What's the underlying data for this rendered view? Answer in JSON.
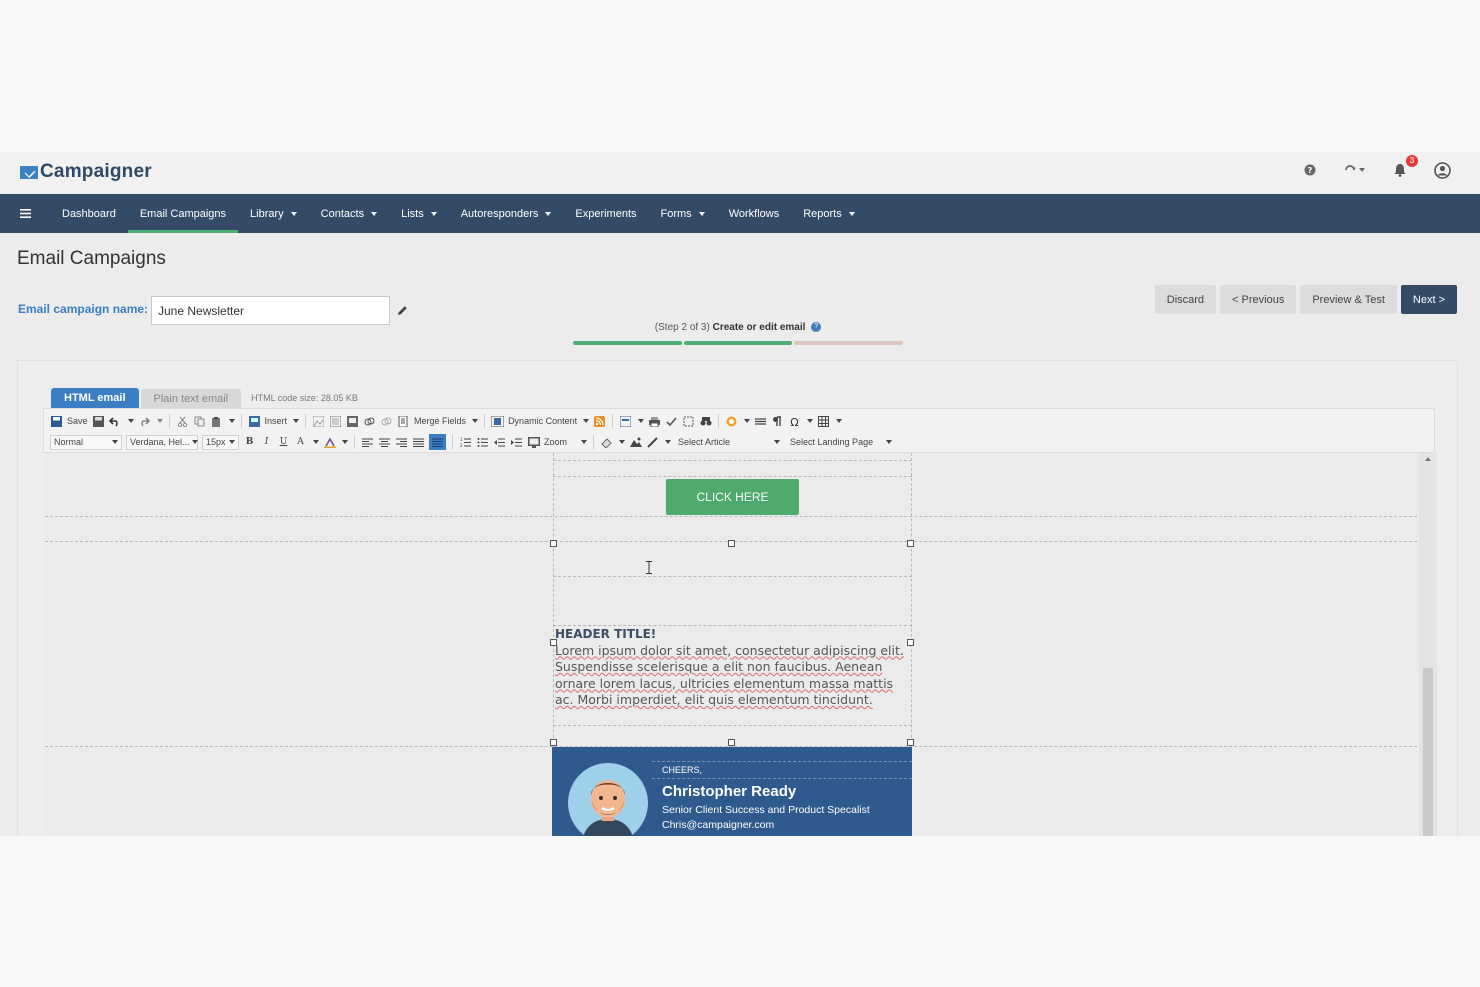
{
  "header": {
    "logo_text": "Campaigner",
    "icons": [
      "help-icon",
      "sync-icon",
      "bell-icon",
      "user-icon"
    ],
    "notification_count": "3"
  },
  "nav": {
    "items": [
      {
        "label": "Dashboard",
        "dropdown": false
      },
      {
        "label": "Email Campaigns",
        "dropdown": false,
        "active": true
      },
      {
        "label": "Library",
        "dropdown": true
      },
      {
        "label": "Contacts",
        "dropdown": true
      },
      {
        "label": "Lists",
        "dropdown": true
      },
      {
        "label": "Autoresponders",
        "dropdown": true
      },
      {
        "label": "Experiments",
        "dropdown": false
      },
      {
        "label": "Forms",
        "dropdown": true
      },
      {
        "label": "Workflows",
        "dropdown": false
      },
      {
        "label": "Reports",
        "dropdown": true
      }
    ]
  },
  "page": {
    "title": "Email Campaigns",
    "campaign_name_label": "Email campaign name:",
    "campaign_name_value": "June Newsletter"
  },
  "actions": {
    "discard": "Discard",
    "previous": "< Previous",
    "preview": "Preview & Test",
    "next": "Next >"
  },
  "step": {
    "prefix": "(Step 2 of 3)",
    "label": "Create or edit email",
    "help": "?",
    "completed_fraction": 0.667
  },
  "colors": {
    "nav_bg": "#344a67",
    "accent_blue": "#3b7ec4",
    "accent_green": "#4caf73",
    "progress_rest": "#d9c7bf"
  },
  "editor": {
    "tab_html": "HTML email",
    "tab_plain": "Plain text email",
    "code_size": "HTML code size: 28.05 KB",
    "toolbar": {
      "save": "Save",
      "insert": "Insert",
      "merge_fields": "Merge Fields",
      "dynamic_content": "Dynamic Content",
      "format": "Normal",
      "font": "Verdana, Hel...",
      "size": "15px",
      "bold": "B",
      "italic": "I",
      "underline": "U",
      "text_color": "A",
      "zoom": "Zoom",
      "select_article": "Select Article",
      "select_landing_page": "Select Landing Page"
    }
  },
  "email": {
    "cta": "CLICK HERE",
    "header_title": "HEADER TITLE!",
    "body": "Lorem ipsum dolor sit amet, consectetur adipiscing elit. Suspendisse scelerisque a elit non faucibus. Aenean ornare lorem lacus, ultricies elementum massa mattis ac. Morbi imperdiet, elit quis elementum tincidunt.",
    "signature": {
      "greeting": "CHEERS,",
      "name": "Christopher Ready",
      "role": "Senior Client Success and Product Specalist",
      "email": "Chris@campaigner.com"
    }
  }
}
